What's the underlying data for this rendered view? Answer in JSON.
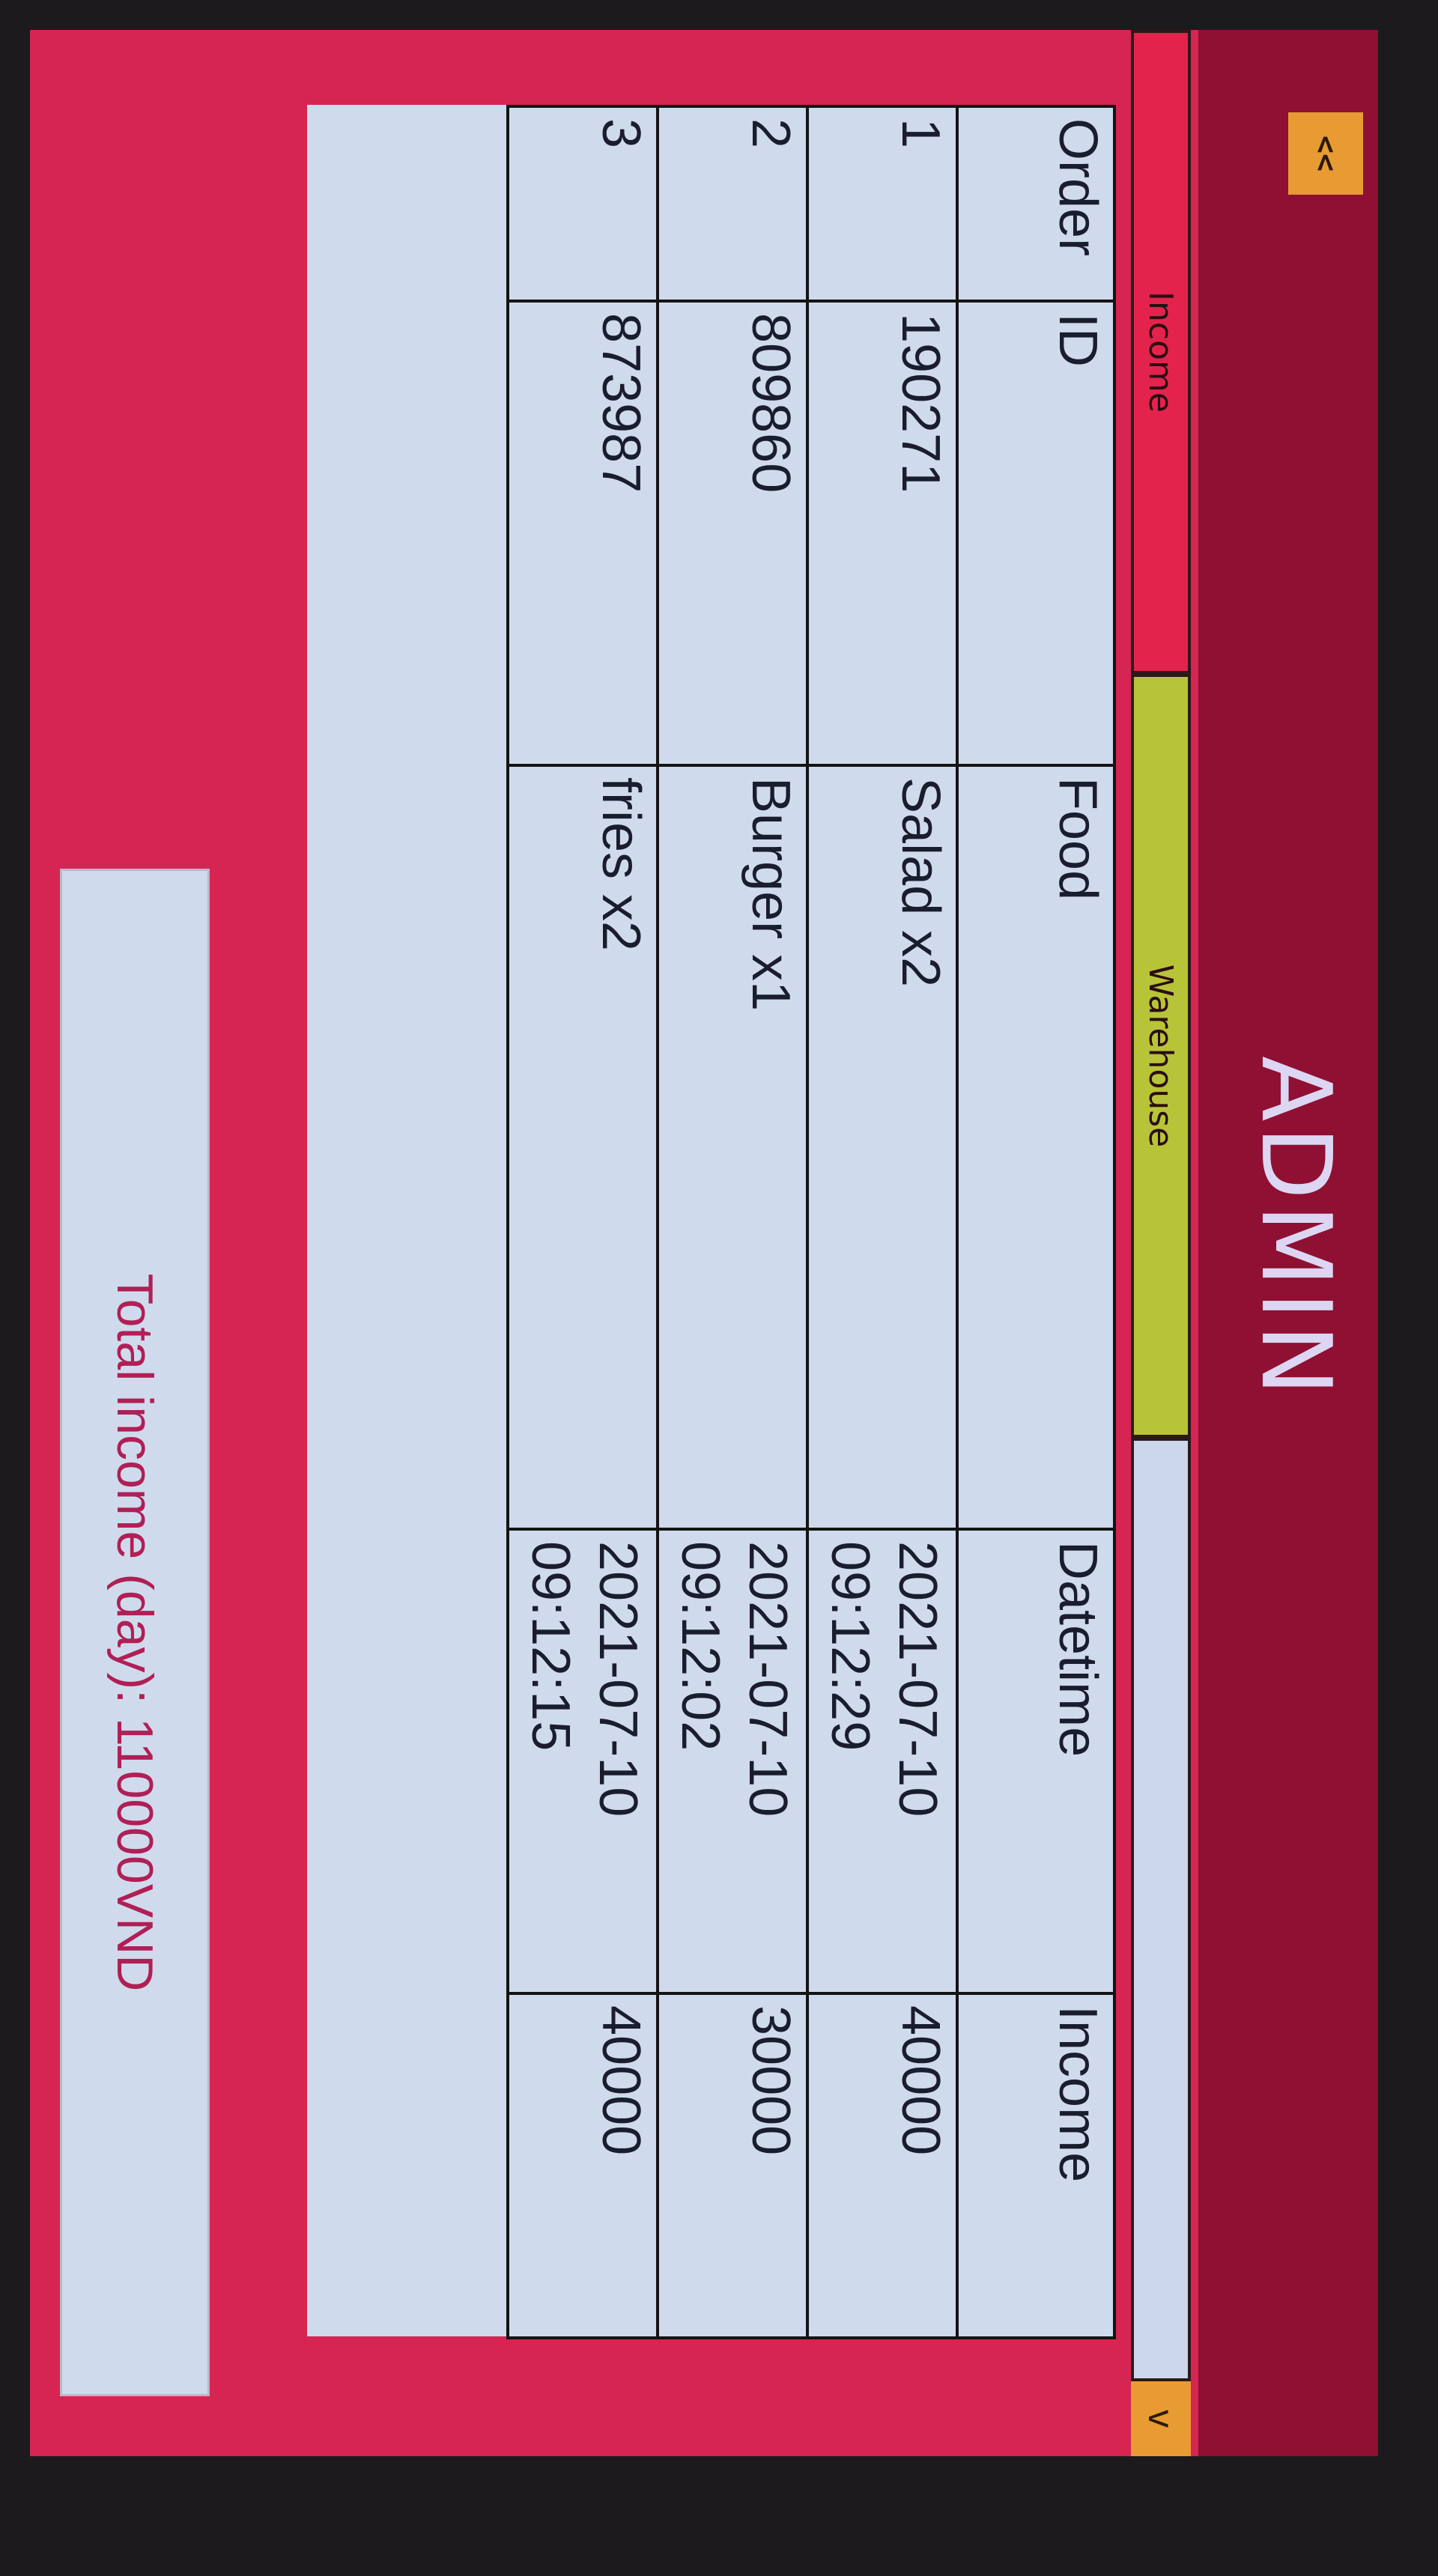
{
  "header": {
    "back_label": "<<",
    "title": "ADMIN"
  },
  "tabs": [
    {
      "label": "Income",
      "active": true
    },
    {
      "label": "Warehouse",
      "active": false
    }
  ],
  "dropdown_label": "v",
  "table": {
    "columns": [
      "Order",
      "ID",
      "Food",
      "Datetime",
      "Income"
    ],
    "rows": [
      {
        "order": "1",
        "id": "190271",
        "food": "Salad x2",
        "date": "2021-07-10",
        "time": "09:12:29",
        "income": "40000"
      },
      {
        "order": "2",
        "id": "809860",
        "food": "Burger x1",
        "date": "2021-07-10",
        "time": "09:12:02",
        "income": "30000"
      },
      {
        "order": "3",
        "id": "873987",
        "food": "fries x2",
        "date": "2021-07-10",
        "time": "09:12:15",
        "income": "40000"
      }
    ]
  },
  "total_text": "Total income (day): 110000VND",
  "colors": {
    "frame": "#d62552",
    "header": "#8f1033",
    "income_tab": "#e4234d",
    "warehouse_tab": "#b8c437",
    "accent": "#e79b32",
    "panel": "#cfdbed"
  }
}
